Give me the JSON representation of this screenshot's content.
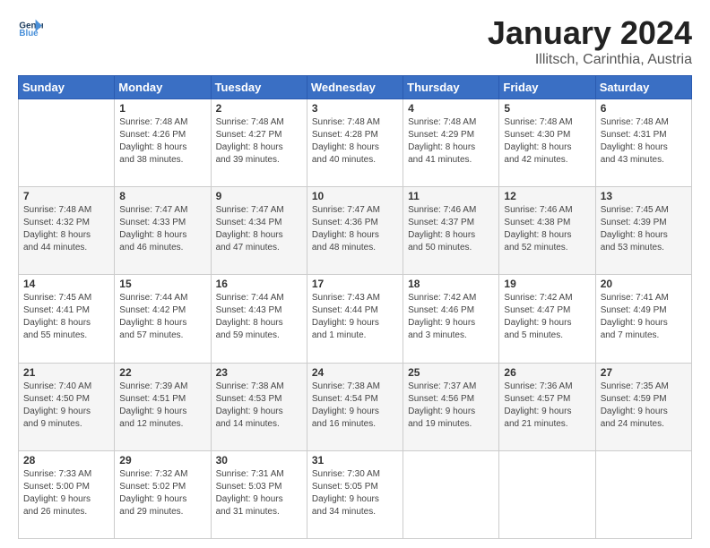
{
  "header": {
    "logo_general": "General",
    "logo_blue": "Blue",
    "title": "January 2024",
    "subtitle": "Illitsch, Carinthia, Austria"
  },
  "days_of_week": [
    "Sunday",
    "Monday",
    "Tuesday",
    "Wednesday",
    "Thursday",
    "Friday",
    "Saturday"
  ],
  "weeks": [
    [
      {
        "num": "",
        "info": ""
      },
      {
        "num": "1",
        "info": "Sunrise: 7:48 AM\nSunset: 4:26 PM\nDaylight: 8 hours\nand 38 minutes."
      },
      {
        "num": "2",
        "info": "Sunrise: 7:48 AM\nSunset: 4:27 PM\nDaylight: 8 hours\nand 39 minutes."
      },
      {
        "num": "3",
        "info": "Sunrise: 7:48 AM\nSunset: 4:28 PM\nDaylight: 8 hours\nand 40 minutes."
      },
      {
        "num": "4",
        "info": "Sunrise: 7:48 AM\nSunset: 4:29 PM\nDaylight: 8 hours\nand 41 minutes."
      },
      {
        "num": "5",
        "info": "Sunrise: 7:48 AM\nSunset: 4:30 PM\nDaylight: 8 hours\nand 42 minutes."
      },
      {
        "num": "6",
        "info": "Sunrise: 7:48 AM\nSunset: 4:31 PM\nDaylight: 8 hours\nand 43 minutes."
      }
    ],
    [
      {
        "num": "7",
        "info": "Sunrise: 7:48 AM\nSunset: 4:32 PM\nDaylight: 8 hours\nand 44 minutes."
      },
      {
        "num": "8",
        "info": "Sunrise: 7:47 AM\nSunset: 4:33 PM\nDaylight: 8 hours\nand 46 minutes."
      },
      {
        "num": "9",
        "info": "Sunrise: 7:47 AM\nSunset: 4:34 PM\nDaylight: 8 hours\nand 47 minutes."
      },
      {
        "num": "10",
        "info": "Sunrise: 7:47 AM\nSunset: 4:36 PM\nDaylight: 8 hours\nand 48 minutes."
      },
      {
        "num": "11",
        "info": "Sunrise: 7:46 AM\nSunset: 4:37 PM\nDaylight: 8 hours\nand 50 minutes."
      },
      {
        "num": "12",
        "info": "Sunrise: 7:46 AM\nSunset: 4:38 PM\nDaylight: 8 hours\nand 52 minutes."
      },
      {
        "num": "13",
        "info": "Sunrise: 7:45 AM\nSunset: 4:39 PM\nDaylight: 8 hours\nand 53 minutes."
      }
    ],
    [
      {
        "num": "14",
        "info": "Sunrise: 7:45 AM\nSunset: 4:41 PM\nDaylight: 8 hours\nand 55 minutes."
      },
      {
        "num": "15",
        "info": "Sunrise: 7:44 AM\nSunset: 4:42 PM\nDaylight: 8 hours\nand 57 minutes."
      },
      {
        "num": "16",
        "info": "Sunrise: 7:44 AM\nSunset: 4:43 PM\nDaylight: 8 hours\nand 59 minutes."
      },
      {
        "num": "17",
        "info": "Sunrise: 7:43 AM\nSunset: 4:44 PM\nDaylight: 9 hours\nand 1 minute."
      },
      {
        "num": "18",
        "info": "Sunrise: 7:42 AM\nSunset: 4:46 PM\nDaylight: 9 hours\nand 3 minutes."
      },
      {
        "num": "19",
        "info": "Sunrise: 7:42 AM\nSunset: 4:47 PM\nDaylight: 9 hours\nand 5 minutes."
      },
      {
        "num": "20",
        "info": "Sunrise: 7:41 AM\nSunset: 4:49 PM\nDaylight: 9 hours\nand 7 minutes."
      }
    ],
    [
      {
        "num": "21",
        "info": "Sunrise: 7:40 AM\nSunset: 4:50 PM\nDaylight: 9 hours\nand 9 minutes."
      },
      {
        "num": "22",
        "info": "Sunrise: 7:39 AM\nSunset: 4:51 PM\nDaylight: 9 hours\nand 12 minutes."
      },
      {
        "num": "23",
        "info": "Sunrise: 7:38 AM\nSunset: 4:53 PM\nDaylight: 9 hours\nand 14 minutes."
      },
      {
        "num": "24",
        "info": "Sunrise: 7:38 AM\nSunset: 4:54 PM\nDaylight: 9 hours\nand 16 minutes."
      },
      {
        "num": "25",
        "info": "Sunrise: 7:37 AM\nSunset: 4:56 PM\nDaylight: 9 hours\nand 19 minutes."
      },
      {
        "num": "26",
        "info": "Sunrise: 7:36 AM\nSunset: 4:57 PM\nDaylight: 9 hours\nand 21 minutes."
      },
      {
        "num": "27",
        "info": "Sunrise: 7:35 AM\nSunset: 4:59 PM\nDaylight: 9 hours\nand 24 minutes."
      }
    ],
    [
      {
        "num": "28",
        "info": "Sunrise: 7:33 AM\nSunset: 5:00 PM\nDaylight: 9 hours\nand 26 minutes."
      },
      {
        "num": "29",
        "info": "Sunrise: 7:32 AM\nSunset: 5:02 PM\nDaylight: 9 hours\nand 29 minutes."
      },
      {
        "num": "30",
        "info": "Sunrise: 7:31 AM\nSunset: 5:03 PM\nDaylight: 9 hours\nand 31 minutes."
      },
      {
        "num": "31",
        "info": "Sunrise: 7:30 AM\nSunset: 5:05 PM\nDaylight: 9 hours\nand 34 minutes."
      },
      {
        "num": "",
        "info": ""
      },
      {
        "num": "",
        "info": ""
      },
      {
        "num": "",
        "info": ""
      }
    ]
  ]
}
